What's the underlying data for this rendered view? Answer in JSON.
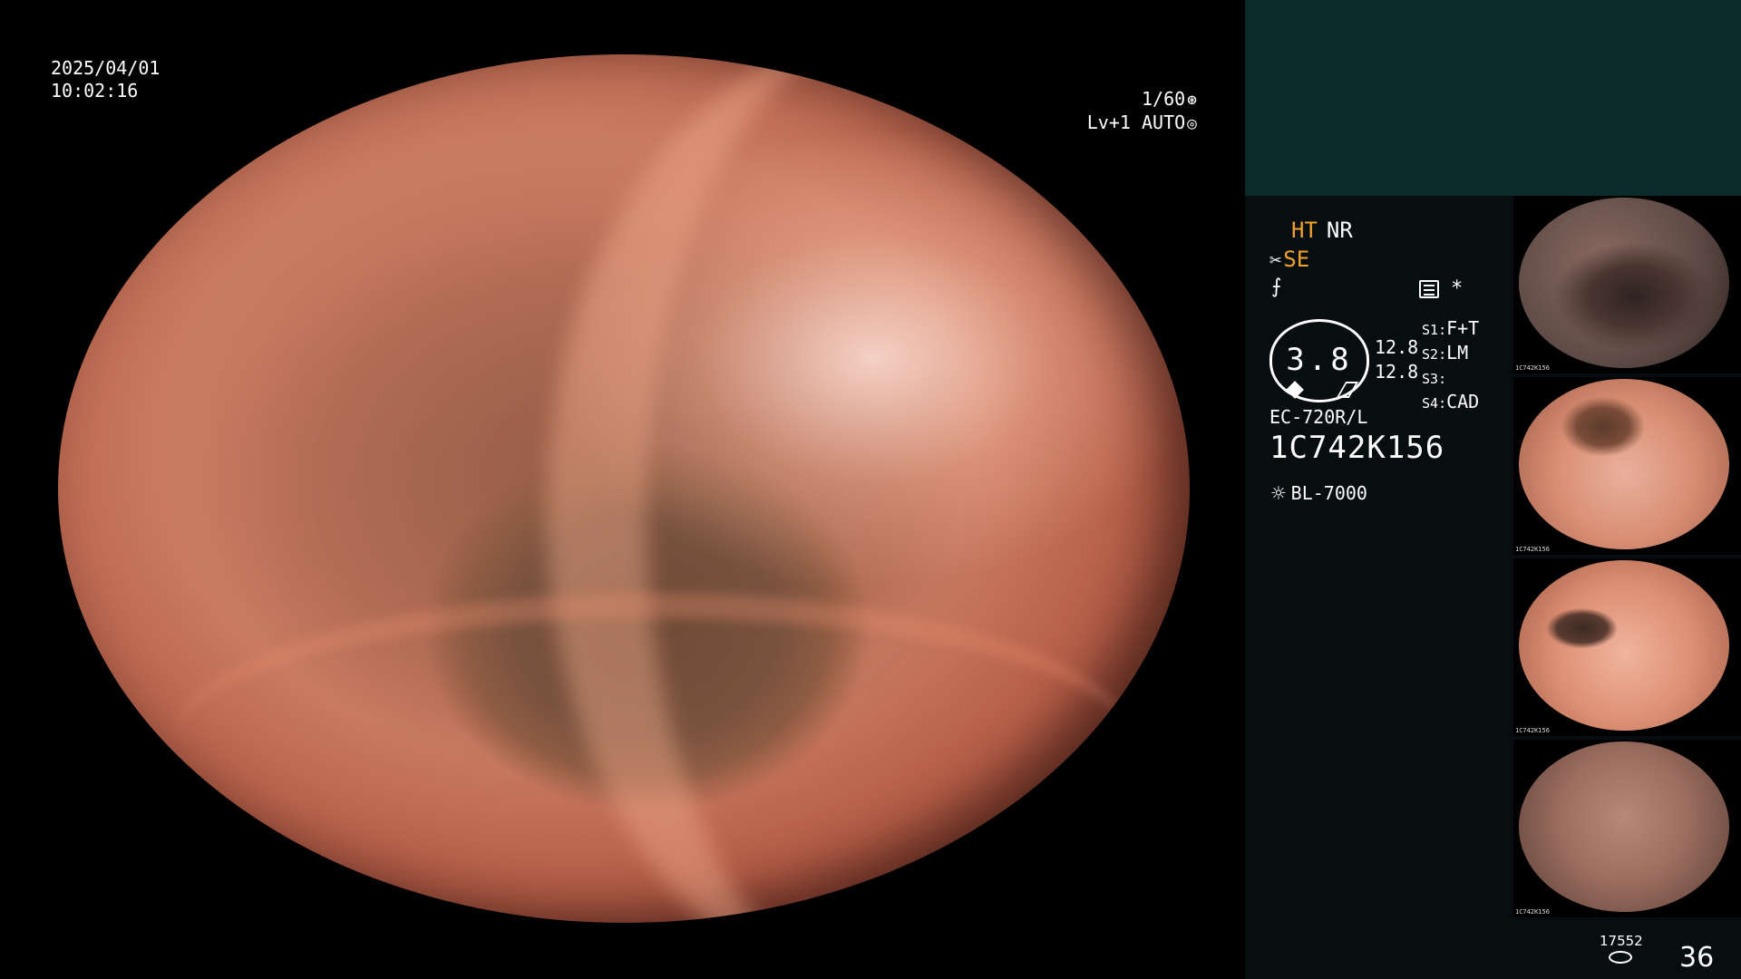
{
  "scope_view": {
    "date": "2025/04/01",
    "time": "10:02:16",
    "shutter": "1/60",
    "level": "Lv+1",
    "iris_mode": "AUTO"
  },
  "info_panel": {
    "ht": "HT",
    "nr": "NR",
    "se": "SE",
    "f_symbol": "⨍",
    "star": "*",
    "gauge_value": "3.8",
    "readings": [
      "12.8",
      "12.8"
    ],
    "settings": [
      {
        "key": "S1",
        "value": "F+T"
      },
      {
        "key": "S2",
        "value": "LM"
      },
      {
        "key": "S3",
        "value": ""
      },
      {
        "key": "S4",
        "value": "CAD"
      }
    ],
    "scope_model": "EC-720R/L",
    "scope_serial": "1C742K156",
    "light_source": "BL-7000"
  },
  "thumbnails": [
    {
      "label": "1C742K156"
    },
    {
      "label": "1C742K156"
    },
    {
      "label": "1C742K156"
    },
    {
      "label": "1C742K156"
    }
  ],
  "footer": {
    "storage_count": "17552",
    "image_count": "36"
  },
  "colors": {
    "accent_orange": "#f2a12d",
    "panel_teal": "#0b2a2a",
    "panel_dark": "#070e0f"
  },
  "icons": [
    "shutter-icon",
    "iris-icon",
    "scissors-icon",
    "menu-icon",
    "sun-icon",
    "disk-icon"
  ]
}
